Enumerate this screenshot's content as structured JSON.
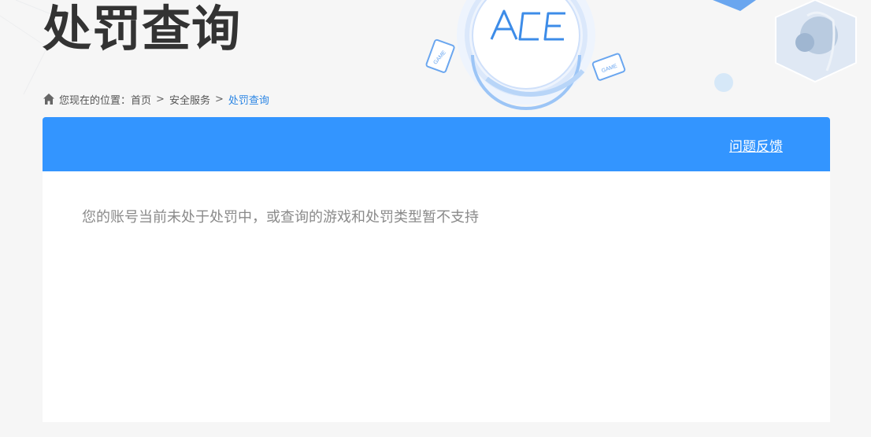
{
  "page": {
    "title": "处罚查询"
  },
  "logo": {
    "text": "ACE",
    "badge_left": "GAME",
    "badge_right": "GAME"
  },
  "breadcrumb": {
    "prefix": "您现在的位置：",
    "items": [
      "首页",
      "安全服务",
      "处罚查询"
    ],
    "separator": ">"
  },
  "panel": {
    "feedback_label": "问题反馈",
    "message": "您的账号当前未处于处罚中，或查询的游戏和处罚类型暂不支持"
  },
  "colors": {
    "header_blue": "#3395ff",
    "breadcrumb_current": "#2c86e4",
    "title_text": "#333333",
    "message_text": "#8a8a8a"
  }
}
